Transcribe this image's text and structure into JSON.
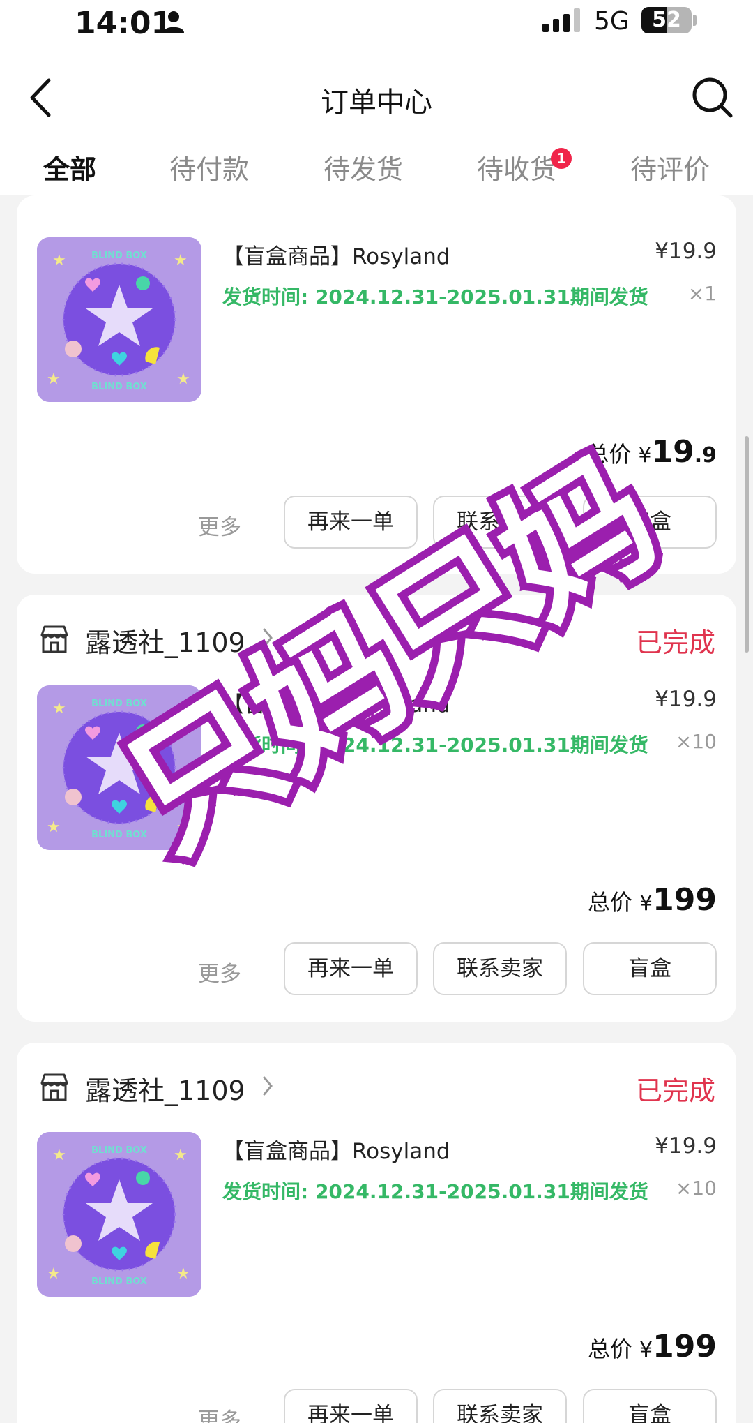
{
  "status_bar": {
    "time": "14:01",
    "network": "5G",
    "battery": "52",
    "battery_level": 0.52
  },
  "header": {
    "title": "订单中心"
  },
  "tabs": [
    {
      "label": "全部",
      "active": true
    },
    {
      "label": "待付款"
    },
    {
      "label": "待发货"
    },
    {
      "label": "待收货",
      "badge": "1"
    },
    {
      "label": "待评价"
    }
  ],
  "watermark": {
    "text": "只妈只妈",
    "color": "#9b1fae"
  },
  "accent_color": "#e8274b",
  "ship_color": "#35b866",
  "orders": [
    {
      "product_title": "【盲盒商品】Rosyland",
      "ship_time": "发货时间: 2024.12.31-2025.01.31期间发货",
      "price": "¥19.9",
      "qty": "×1",
      "total_label": "总价",
      "total_yen": "¥",
      "total_int": "19",
      "total_dec": ".9",
      "more": "更多",
      "buttons": [
        "再来一单",
        "联系卖家",
        "盲盒"
      ]
    },
    {
      "shop_name": "露透社_1109",
      "status": "已完成",
      "product_title": "【盲盒商品】Rosyland",
      "ship_time": "发货时间: 2024.12.31-2025.01.31期间发货",
      "price": "¥19.9",
      "qty": "×10",
      "total_label": "总价",
      "total_yen": "¥",
      "total_int": "199",
      "more": "更多",
      "buttons": [
        "再来一单",
        "联系卖家",
        "盲盒"
      ]
    },
    {
      "shop_name": "露透社_1109",
      "status": "已完成",
      "product_title": "【盲盒商品】Rosyland",
      "ship_time": "发货时间: 2024.12.31-2025.01.31期间发货",
      "price": "¥19.9",
      "qty": "×10",
      "total_label": "总价",
      "total_yen": "¥",
      "total_int": "199",
      "more": "更多",
      "buttons": [
        "再来一单",
        "联系卖家",
        "盲盒"
      ]
    }
  ],
  "thumbnail": {
    "label_top": "BLIND BOX",
    "label_bottom": "BLIND BOX"
  }
}
